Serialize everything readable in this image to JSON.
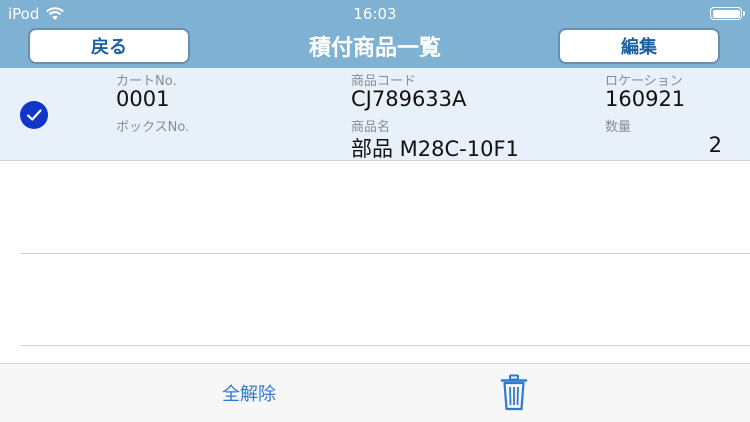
{
  "status_bar": {
    "carrier": "iPod",
    "time": "16:03"
  },
  "nav": {
    "back_label": "戻る",
    "title": "積付商品一覧",
    "edit_label": "編集"
  },
  "rows": [
    {
      "cart_label": "カートNo.",
      "cart_value": "0001",
      "box_label": "ボックスNo.",
      "box_value": "",
      "code_label": "商品コード",
      "code_value": "CJ789633A",
      "name_label": "商品名",
      "name_value": "部品 M28C-10F1",
      "location_label": "ロケーション",
      "location_value": "160921",
      "qty_label": "数量",
      "qty_value": "2",
      "selected": true
    }
  ],
  "toolbar": {
    "deselect_all_label": "全解除",
    "trash_icon": "trash-icon"
  },
  "colors": {
    "nav_bar": "#7fb1d3",
    "selected_row": "#e8f0f9",
    "check": "#0f35c9",
    "accent": "#2f7ad0"
  }
}
